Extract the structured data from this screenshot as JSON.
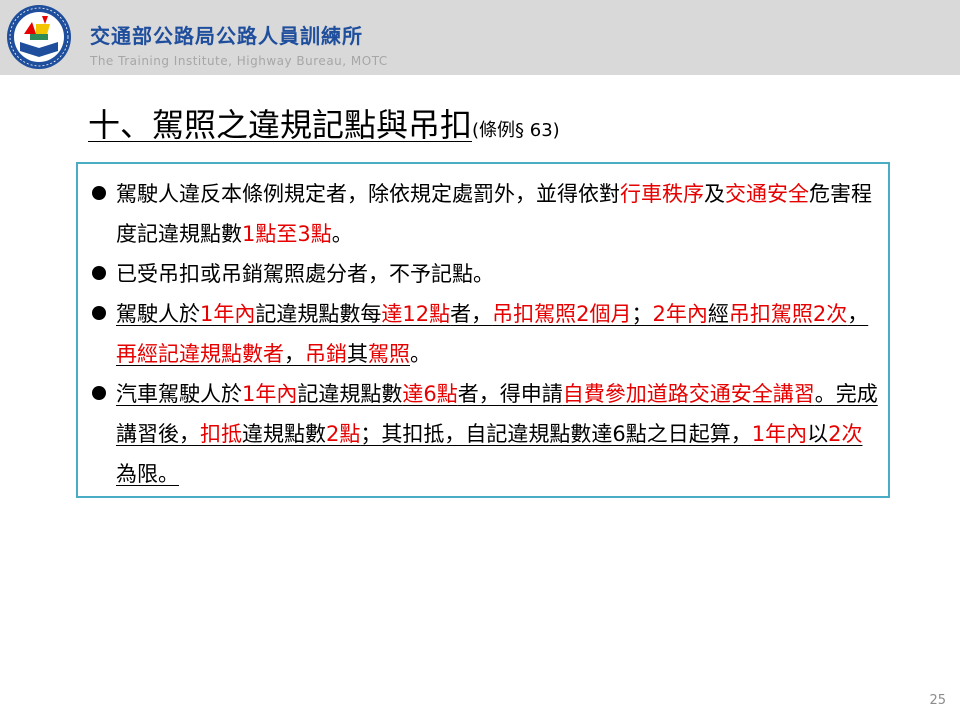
{
  "header": {
    "org_name": "交通部公路局公路人員訓練所",
    "org_name_en": "The Training Institute, Highway Bureau,  MOTC",
    "logo_icon": "training-institute-logo-icon"
  },
  "slide": {
    "title": "十、駕照之違規記點與吊扣",
    "title_ref": "(條例§ 63)",
    "page_number": "25"
  },
  "colors": {
    "accent_red": "#e60000",
    "box_border": "#4bacc6",
    "header_text": "#1f4e9c"
  },
  "bullets": [
    {
      "segments": [
        {
          "t": "駕駛人違反本條例規定者，除依規定處罰外，並得依對"
        },
        {
          "t": "行車秩序",
          "red": true
        },
        {
          "t": "及"
        },
        {
          "t": "交通安全",
          "red": true
        },
        {
          "t": "危害程度記違規點數"
        },
        {
          "t": "1點至3點",
          "red": true
        },
        {
          "t": "。"
        }
      ]
    },
    {
      "segments": [
        {
          "t": "已受吊扣或吊銷駕照處分者，不予記點。"
        }
      ]
    },
    {
      "segments": [
        {
          "t": "駕駛人於",
          "u": true
        },
        {
          "t": "1年內",
          "red": true,
          "u": true
        },
        {
          "t": "記違規點數每",
          "u": true
        },
        {
          "t": "達12點",
          "red": true,
          "u": true
        },
        {
          "t": "者，",
          "u": true
        },
        {
          "t": "吊扣駕照2個月",
          "red": true,
          "u": true
        },
        {
          "t": "；",
          "u": true
        },
        {
          "t": "2年內",
          "red": true,
          "u": true
        },
        {
          "t": "經",
          "u": true
        },
        {
          "t": "吊扣駕照2次",
          "red": true,
          "u": true
        },
        {
          "t": "，",
          "u": true
        },
        {
          "t": "再經記違規點數者",
          "red": true,
          "u": true
        },
        {
          "t": "，",
          "u": true
        },
        {
          "t": "吊銷",
          "red": true,
          "u": true
        },
        {
          "t": "其",
          "u": true
        },
        {
          "t": "駕照",
          "red": true,
          "u": true
        },
        {
          "t": "。"
        }
      ]
    },
    {
      "segments": [
        {
          "t": "汽車駕駛人於",
          "u": true
        },
        {
          "t": "1年內",
          "red": true,
          "u": true
        },
        {
          "t": "記違規點數",
          "u": true
        },
        {
          "t": "達6點",
          "red": true,
          "u": true
        },
        {
          "t": "者，得申請",
          "u": true
        },
        {
          "t": "自費參加道路交通安全講習",
          "red": true,
          "u": true
        },
        {
          "t": "。完成講習後，",
          "u": true
        },
        {
          "t": "扣抵",
          "red": true,
          "u": true
        },
        {
          "t": "違規點數",
          "u": true
        },
        {
          "t": "2點",
          "red": true,
          "u": true
        },
        {
          "t": "；其扣抵，自記違規點數達6點之日起算，",
          "u": true
        },
        {
          "t": "1年內",
          "red": true,
          "u": true
        },
        {
          "t": "以",
          "u": true
        },
        {
          "t": "2次",
          "red": true,
          "u": true
        },
        {
          "t": "為限。",
          "u": true
        }
      ]
    }
  ]
}
